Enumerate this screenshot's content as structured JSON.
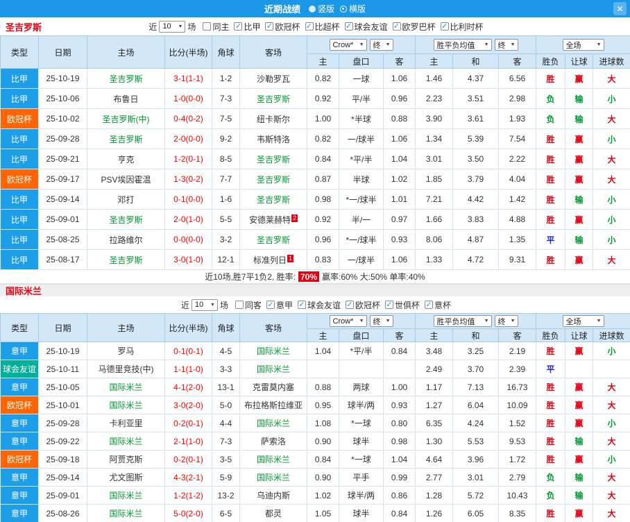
{
  "header": {
    "title": "近期战绩",
    "view_options": [
      {
        "label": "竖版",
        "selected": false
      },
      {
        "label": "横版",
        "selected": true
      }
    ],
    "close_icon": "✕"
  },
  "icons": {
    "chevron_down": "▼",
    "check": "✓"
  },
  "filter_labels": {
    "near": "近",
    "matches": "场"
  },
  "color_map": {
    "胜": "#e60012",
    "负": "#009933",
    "平": "#2222cc",
    "赢": "#e60012",
    "输": "#009933",
    "大": "#e60012",
    "小": "#009933"
  },
  "type_colors": {
    "比甲": "#1c9ee9",
    "意甲": "#1c9ee9",
    "欧冠杯": "#ff6501",
    "球会友谊": "#00b09b"
  },
  "table_headers": {
    "type": "类型",
    "date": "日期",
    "home": "主场",
    "score": "比分(半场)",
    "corner": "角球",
    "away": "客场",
    "asia_selects": [
      "Crow*",
      "终"
    ],
    "europe_selects": [
      "胜平负均值",
      "终"
    ],
    "full_selects": [
      "全场"
    ],
    "sub": [
      "主",
      "盘口",
      "客",
      "主",
      "和",
      "客",
      "胜负",
      "让球",
      "进球数"
    ]
  },
  "sections": [
    {
      "team": "圣吉罗斯",
      "count": "10",
      "checkboxes": [
        {
          "label": "同主",
          "checked": false
        },
        {
          "label": "比甲",
          "checked": true
        },
        {
          "label": "欧冠杯",
          "checked": true
        },
        {
          "label": "比超杯",
          "checked": true
        },
        {
          "label": "球会友谊",
          "checked": true
        },
        {
          "label": "欧罗巴杯",
          "checked": true
        },
        {
          "label": "比利时杯",
          "checked": true
        }
      ],
      "rows": [
        {
          "type": "比甲",
          "date": "25-10-19",
          "home": "圣吉罗斯",
          "home_focus": true,
          "score": "3-1(1-1)",
          "corner": "1-2",
          "away": "沙勒罗瓦",
          "ah_home": "0.82",
          "ah_line": "一球",
          "ah_away": "1.06",
          "eu_home": "1.46",
          "eu_draw": "4.37",
          "eu_away": "6.56",
          "result": "胜",
          "handicap": "赢",
          "goals": "大"
        },
        {
          "type": "比甲",
          "date": "25-10-06",
          "home": "布鲁日",
          "score": "1-0(0-0)",
          "corner": "7-3",
          "away": "圣吉罗斯",
          "away_focus": true,
          "ah_home": "0.92",
          "ah_line": "平/半",
          "ah_away": "0.96",
          "eu_home": "2.23",
          "eu_draw": "3.51",
          "eu_away": "2.98",
          "result": "负",
          "handicap": "输",
          "goals": "小"
        },
        {
          "type": "欧冠杯",
          "date": "25-10-02",
          "home": "圣吉罗斯(中)",
          "home_focus": true,
          "score": "0-4(0-2)",
          "corner": "7-5",
          "away": "纽卡斯尔",
          "ah_home": "1.00",
          "ah_line": "*半球",
          "ah_away": "0.88",
          "eu_home": "3.90",
          "eu_draw": "3.61",
          "eu_away": "1.93",
          "result": "负",
          "handicap": "输",
          "goals": "大"
        },
        {
          "type": "比甲",
          "date": "25-09-28",
          "home": "圣吉罗斯",
          "home_focus": true,
          "score": "2-0(0-0)",
          "corner": "9-2",
          "away": "韦斯特洛",
          "ah_home": "0.82",
          "ah_line": "一/球半",
          "ah_away": "1.06",
          "eu_home": "1.34",
          "eu_draw": "5.39",
          "eu_away": "7.54",
          "result": "胜",
          "handicap": "赢",
          "goals": "小"
        },
        {
          "type": "比甲",
          "date": "25-09-21",
          "home": "亨克",
          "score": "1-2(0-1)",
          "corner": "8-5",
          "away": "圣吉罗斯",
          "away_focus": true,
          "ah_home": "0.84",
          "ah_line": "*平/半",
          "ah_away": "1.04",
          "eu_home": "3.01",
          "eu_draw": "3.50",
          "eu_away": "2.22",
          "result": "胜",
          "handicap": "赢",
          "goals": "大"
        },
        {
          "type": "欧冠杯",
          "date": "25-09-17",
          "home": "PSV埃因霍温",
          "score": "1-3(0-2)",
          "corner": "7-7",
          "away": "圣吉罗斯",
          "away_focus": true,
          "ah_home": "0.87",
          "ah_line": "半球",
          "ah_away": "1.02",
          "eu_home": "1.85",
          "eu_draw": "3.79",
          "eu_away": "4.04",
          "result": "胜",
          "handicap": "赢",
          "goals": "大"
        },
        {
          "type": "比甲",
          "date": "25-09-14",
          "home": "邓打",
          "score": "0-1(0-0)",
          "corner": "1-6",
          "away": "圣吉罗斯",
          "away_focus": true,
          "ah_home": "0.98",
          "ah_line": "*一/球半",
          "ah_away": "1.01",
          "eu_home": "7.21",
          "eu_draw": "4.42",
          "eu_away": "1.42",
          "result": "胜",
          "handicap": "输",
          "goals": "小"
        },
        {
          "type": "比甲",
          "date": "25-09-01",
          "home": "圣吉罗斯",
          "home_focus": true,
          "score": "2-0(1-0)",
          "corner": "5-5",
          "away": "安德莱赫特",
          "away_badge": "2",
          "ah_home": "0.92",
          "ah_line": "半/一",
          "ah_away": "0.97",
          "eu_home": "1.66",
          "eu_draw": "3.83",
          "eu_away": "4.88",
          "result": "胜",
          "handicap": "赢",
          "goals": "小"
        },
        {
          "type": "比甲",
          "date": "25-08-25",
          "home": "拉路维尔",
          "score": "0-0(0-0)",
          "corner": "3-2",
          "away": "圣吉罗斯",
          "away_focus": true,
          "ah_home": "0.96",
          "ah_line": "*一/球半",
          "ah_away": "0.93",
          "eu_home": "8.06",
          "eu_draw": "4.87",
          "eu_away": "1.35",
          "result": "平",
          "handicap": "输",
          "goals": "小"
        },
        {
          "type": "比甲",
          "date": "25-08-17",
          "home": "圣吉罗斯",
          "home_focus": true,
          "score": "3-0(1-0)",
          "corner": "12-1",
          "away": "标准列日",
          "away_badge": "1",
          "ah_home": "0.83",
          "ah_line": "一/球半",
          "ah_away": "1.06",
          "eu_home": "1.33",
          "eu_draw": "4.72",
          "eu_away": "9.31",
          "result": "胜",
          "handicap": "赢",
          "goals": "大"
        }
      ],
      "summary": {
        "prefix": "近10场,胜7平1负2, 胜率:",
        "rate": "70%",
        "suffix": "赢率:60% 大:50% 单率:40%"
      }
    },
    {
      "team": "国际米兰",
      "count": "10",
      "checkboxes": [
        {
          "label": "同客",
          "checked": false
        },
        {
          "label": "意甲",
          "checked": true
        },
        {
          "label": "球会友谊",
          "checked": true
        },
        {
          "label": "欧冠杯",
          "checked": true
        },
        {
          "label": "世俱杯",
          "checked": true
        },
        {
          "label": "意杯",
          "checked": true
        }
      ],
      "rows": [
        {
          "type": "意甲",
          "date": "25-10-19",
          "home": "罗马",
          "score": "0-1(0-1)",
          "corner": "4-5",
          "away": "国际米兰",
          "away_focus": true,
          "ah_home": "1.04",
          "ah_line": "*平/半",
          "ah_away": "0.84",
          "eu_home": "3.48",
          "eu_draw": "3.25",
          "eu_away": "2.19",
          "result": "胜",
          "handicap": "赢",
          "goals": "小"
        },
        {
          "type": "球会友谊",
          "date": "25-10-11",
          "home": "马德里竞技(中)",
          "score": "1-1(1-0)",
          "corner": "3-3",
          "away": "国际米兰",
          "away_focus": true,
          "ah_home": "",
          "ah_line": "",
          "ah_away": "",
          "eu_home": "2.49",
          "eu_draw": "3.70",
          "eu_away": "2.39",
          "result": "平",
          "handicap": "",
          "goals": ""
        },
        {
          "type": "意甲",
          "date": "25-10-05",
          "home": "国际米兰",
          "home_focus": true,
          "score": "4-1(2-0)",
          "corner": "13-1",
          "away": "克雷莫内塞",
          "ah_home": "0.88",
          "ah_line": "两球",
          "ah_away": "1.00",
          "eu_home": "1.17",
          "eu_draw": "7.13",
          "eu_away": "16.73",
          "result": "胜",
          "handicap": "赢",
          "goals": "大"
        },
        {
          "type": "欧冠杯",
          "date": "25-10-01",
          "home": "国际米兰",
          "home_focus": true,
          "score": "3-0(2-0)",
          "corner": "5-0",
          "away": "布拉格斯拉维亚",
          "ah_home": "0.95",
          "ah_line": "球半/两",
          "ah_away": "0.93",
          "eu_home": "1.27",
          "eu_draw": "6.04",
          "eu_away": "10.09",
          "result": "胜",
          "handicap": "赢",
          "goals": "大"
        },
        {
          "type": "意甲",
          "date": "25-09-28",
          "home": "卡利亚里",
          "score": "0-2(0-1)",
          "corner": "4-4",
          "away": "国际米兰",
          "away_focus": true,
          "ah_home": "1.08",
          "ah_line": "*一球",
          "ah_away": "0.80",
          "eu_home": "6.35",
          "eu_draw": "4.24",
          "eu_away": "1.52",
          "result": "胜",
          "handicap": "赢",
          "goals": "小"
        },
        {
          "type": "意甲",
          "date": "25-09-22",
          "home": "国际米兰",
          "home_focus": true,
          "score": "2-1(1-0)",
          "corner": "7-3",
          "away": "萨索洛",
          "ah_home": "0.90",
          "ah_line": "球半",
          "ah_away": "0.98",
          "eu_home": "1.30",
          "eu_draw": "5.53",
          "eu_away": "9.53",
          "result": "胜",
          "handicap": "输",
          "goals": "大"
        },
        {
          "type": "欧冠杯",
          "date": "25-09-18",
          "home": "阿贾克斯",
          "score": "0-2(0-1)",
          "corner": "3-5",
          "away": "国际米兰",
          "away_focus": true,
          "ah_home": "0.84",
          "ah_line": "*一球",
          "ah_away": "1.04",
          "eu_home": "4.64",
          "eu_draw": "3.96",
          "eu_away": "1.72",
          "result": "胜",
          "handicap": "赢",
          "goals": "小"
        },
        {
          "type": "意甲",
          "date": "25-09-14",
          "home": "尤文图斯",
          "score": "4-3(2-1)",
          "corner": "5-9",
          "away": "国际米兰",
          "away_focus": true,
          "ah_home": "0.90",
          "ah_line": "平手",
          "ah_away": "0.99",
          "eu_home": "2.77",
          "eu_draw": "3.01",
          "eu_away": "2.79",
          "result": "负",
          "handicap": "输",
          "goals": "大"
        },
        {
          "type": "意甲",
          "date": "25-09-01",
          "home": "国际米兰",
          "home_focus": true,
          "score": "1-2(1-2)",
          "corner": "13-2",
          "away": "乌迪内斯",
          "ah_home": "1.02",
          "ah_line": "球半/两",
          "ah_away": "0.86",
          "eu_home": "1.28",
          "eu_draw": "5.72",
          "eu_away": "10.43",
          "result": "负",
          "handicap": "输",
          "goals": "大"
        },
        {
          "type": "意甲",
          "date": "25-08-26",
          "home": "国际米兰",
          "home_focus": true,
          "score": "5-0(2-0)",
          "corner": "6-5",
          "away": "都灵",
          "ah_home": "1.05",
          "ah_line": "球半",
          "ah_away": "0.84",
          "eu_home": "1.26",
          "eu_draw": "6.05",
          "eu_away": "8.35",
          "result": "胜",
          "handicap": "赢",
          "goals": "大"
        }
      ]
    }
  ]
}
